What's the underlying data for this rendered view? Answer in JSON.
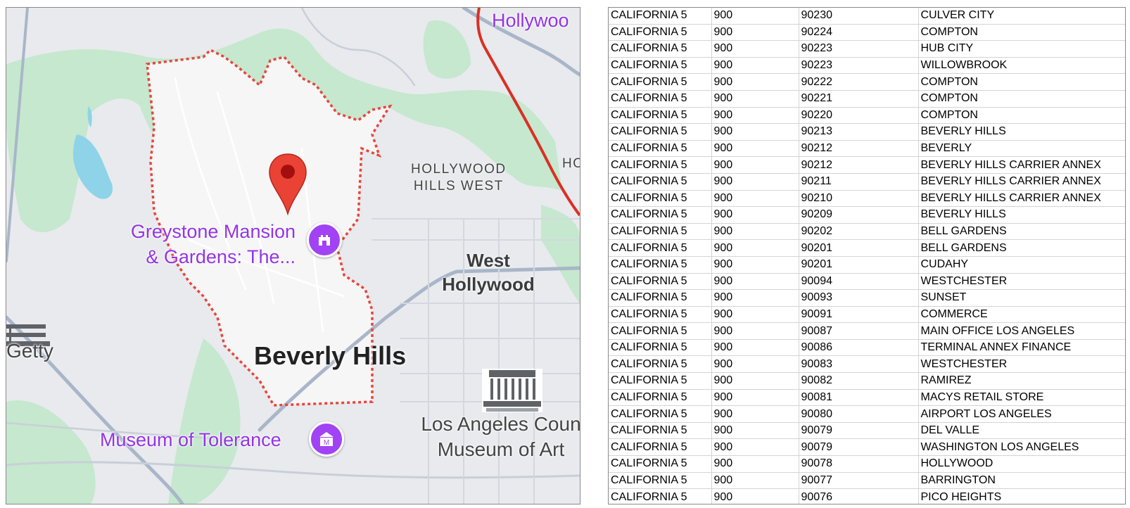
{
  "map": {
    "labels": {
      "hollywood": "Hollywoo",
      "hollywood_west": "HOLLYWOOD\nHILLS WEST",
      "edge_ho": "HO",
      "greystone": "Greystone Mansion\n& Gardens: The...",
      "west_hollywood": "West\nHollywood",
      "getty": "Getty",
      "beverly_hills": "Beverly Hills",
      "museum_tolerance": "Museum of Tolerance",
      "lacma": "Los Angeles Coun\nMuseum of Art"
    },
    "icons": {
      "pin": "map-pin-icon",
      "greystone": "castle-icon",
      "tolerance": "museum-icon",
      "getty": "building-icon",
      "lacma": "museum-building-icon"
    },
    "colors": {
      "pin": "#ea4335",
      "poi": "#a142f4",
      "boundary": "#e8453c",
      "park": "#c5e8cf",
      "water": "#8ed3e8",
      "road": "#a9b6c9",
      "rail": "#d93025"
    }
  },
  "table": {
    "rows": [
      [
        "CALIFORNIA 5",
        "900",
        "90230",
        "CULVER CITY"
      ],
      [
        "CALIFORNIA 5",
        "900",
        "90224",
        "COMPTON"
      ],
      [
        "CALIFORNIA 5",
        "900",
        "90223",
        "HUB CITY"
      ],
      [
        "CALIFORNIA 5",
        "900",
        "90223",
        "WILLOWBROOK"
      ],
      [
        "CALIFORNIA 5",
        "900",
        "90222",
        "COMPTON"
      ],
      [
        "CALIFORNIA 5",
        "900",
        "90221",
        "COMPTON"
      ],
      [
        "CALIFORNIA 5",
        "900",
        "90220",
        "COMPTON"
      ],
      [
        "CALIFORNIA 5",
        "900",
        "90213",
        "BEVERLY HILLS"
      ],
      [
        "CALIFORNIA 5",
        "900",
        "90212",
        "BEVERLY"
      ],
      [
        "CALIFORNIA 5",
        "900",
        "90212",
        "BEVERLY HILLS CARRIER ANNEX"
      ],
      [
        "CALIFORNIA 5",
        "900",
        "90211",
        "BEVERLY HILLS CARRIER ANNEX"
      ],
      [
        "CALIFORNIA 5",
        "900",
        "90210",
        "BEVERLY HILLS CARRIER ANNEX"
      ],
      [
        "CALIFORNIA 5",
        "900",
        "90209",
        "BEVERLY HILLS"
      ],
      [
        "CALIFORNIA 5",
        "900",
        "90202",
        "BELL GARDENS"
      ],
      [
        "CALIFORNIA 5",
        "900",
        "90201",
        "BELL GARDENS"
      ],
      [
        "CALIFORNIA 5",
        "900",
        "90201",
        "CUDAHY"
      ],
      [
        "CALIFORNIA 5",
        "900",
        "90094",
        "WESTCHESTER"
      ],
      [
        "CALIFORNIA 5",
        "900",
        "90093",
        "SUNSET"
      ],
      [
        "CALIFORNIA 5",
        "900",
        "90091",
        "COMMERCE"
      ],
      [
        "CALIFORNIA 5",
        "900",
        "90087",
        "MAIN OFFICE LOS ANGELES"
      ],
      [
        "CALIFORNIA 5",
        "900",
        "90086",
        "TERMINAL ANNEX FINANCE"
      ],
      [
        "CALIFORNIA 5",
        "900",
        "90083",
        "WESTCHESTER"
      ],
      [
        "CALIFORNIA 5",
        "900",
        "90082",
        "RAMIREZ"
      ],
      [
        "CALIFORNIA 5",
        "900",
        "90081",
        "MACYS RETAIL STORE"
      ],
      [
        "CALIFORNIA 5",
        "900",
        "90080",
        "AIRPORT LOS ANGELES"
      ],
      [
        "CALIFORNIA 5",
        "900",
        "90079",
        "DEL VALLE"
      ],
      [
        "CALIFORNIA 5",
        "900",
        "90079",
        "WASHINGTON LOS ANGELES"
      ],
      [
        "CALIFORNIA 5",
        "900",
        "90078",
        "HOLLYWOOD"
      ],
      [
        "CALIFORNIA 5",
        "900",
        "90077",
        "BARRINGTON"
      ],
      [
        "CALIFORNIA 5",
        "900",
        "90076",
        "PICO HEIGHTS"
      ]
    ]
  }
}
